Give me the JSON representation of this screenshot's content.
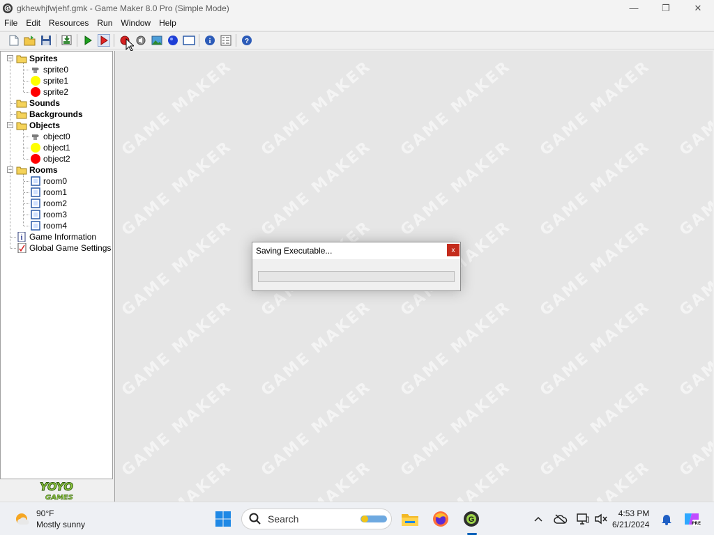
{
  "window": {
    "title": "gkhewhjfwjehf.gmk - Game Maker 8.0 Pro (Simple Mode)",
    "minimize_glyph": "—",
    "restore_glyph": "❐",
    "close_glyph": "✕"
  },
  "menu": {
    "items": [
      "File",
      "Edit",
      "Resources",
      "Run",
      "Window",
      "Help"
    ]
  },
  "toolbar": {
    "buttons": [
      "new-icon",
      "open-icon",
      "save-icon",
      "create-executable-icon",
      "run-icon",
      "run-debug-icon",
      "create-sprite-icon",
      "create-sound-icon",
      "create-background-icon",
      "create-object-icon",
      "create-room-icon",
      "game-information-icon",
      "global-settings-icon",
      "help-icon"
    ]
  },
  "tree": {
    "sprites": {
      "label": "Sprites",
      "children": [
        "sprite0",
        "sprite1",
        "sprite2"
      ]
    },
    "sounds": {
      "label": "Sounds"
    },
    "backgrounds": {
      "label": "Backgrounds"
    },
    "objects": {
      "label": "Objects",
      "children": [
        "object0",
        "object1",
        "object2"
      ]
    },
    "rooms": {
      "label": "Rooms",
      "children": [
        "room0",
        "room1",
        "room2",
        "room3",
        "room4"
      ]
    },
    "game_information": "Game Information",
    "global_game_settings": "Global Game Settings"
  },
  "logo": {
    "line1": "YOYO",
    "line2": "GAMES"
  },
  "watermark": "GAME MAKER",
  "dialog": {
    "title": "Saving Executable...",
    "close_glyph": "x",
    "progress": 0
  },
  "taskbar": {
    "weather_temp": "90°F",
    "weather_desc": "Mostly sunny",
    "search_placeholder": "Search",
    "time": "4:53 PM",
    "date": "6/21/2024"
  },
  "colors": {
    "accent": "#005fb8",
    "close_red": "#c42b1c",
    "sprite_yellow": "#ffff00",
    "sprite_red": "#ff0000",
    "mdi_bg": "#e6e6e6"
  }
}
